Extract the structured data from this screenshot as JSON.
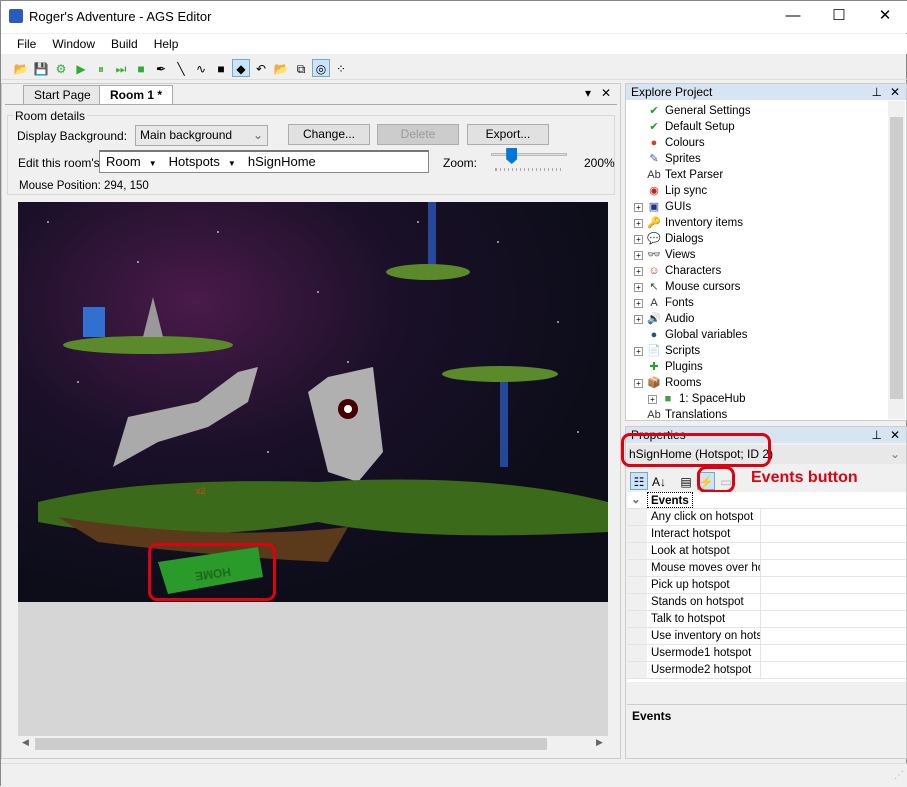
{
  "window": {
    "title": "Roger's Adventure - AGS Editor",
    "minimize": "—",
    "maximize": "☐",
    "close": "✕"
  },
  "menu": [
    "File",
    "Window",
    "Build",
    "Help"
  ],
  "toolbar_icons": [
    "open-icon",
    "save-icon",
    "build-icon",
    "run-icon",
    "pause-icon",
    "step-icon",
    "stop-icon",
    "eyedropper-icon",
    "line-icon",
    "freehand-icon",
    "rectangle-icon",
    "fill-icon",
    "undo-icon",
    "import-icon",
    "copy-walkable-icon",
    "hotspot-select-icon",
    "zoom-icon"
  ],
  "tabs": [
    {
      "label": "Start Page",
      "active": false
    },
    {
      "label": "Room 1 *",
      "active": true
    }
  ],
  "tab_controls": {
    "dropdown": "▾",
    "close": "✕"
  },
  "room": {
    "group_label": "Room details",
    "display_bg_label": "Display Background:",
    "display_bg_value": "Main background",
    "change": "Change...",
    "delete": "Delete",
    "export": "Export...",
    "edit_label": "Edit this room's:",
    "crumb1": "Room",
    "crumb2": "Hotspots",
    "crumb3": "hSignHome",
    "zoom_label": "Zoom:",
    "zoom_value": "200%",
    "zoom_level": 0.2,
    "mouse_pos": "Mouse Position: 294, 150",
    "sign_text": "HOME",
    "cursor_marker": "x2"
  },
  "explore": {
    "title": "Explore Project",
    "items": [
      {
        "label": "General Settings",
        "icon": "✔",
        "color": "#1a9a1a",
        "exp": false
      },
      {
        "label": "Default Setup",
        "icon": "✔",
        "color": "#1a9a1a",
        "exp": false
      },
      {
        "label": "Colours",
        "icon": "●",
        "color": "#d04020",
        "exp": false
      },
      {
        "label": "Sprites",
        "icon": "✎",
        "color": "#3060c0",
        "exp": false
      },
      {
        "label": "Text Parser",
        "icon": "Ab",
        "color": "#333",
        "exp": false
      },
      {
        "label": "Lip sync",
        "icon": "◉",
        "color": "#c02020",
        "exp": false
      },
      {
        "label": "GUIs",
        "icon": "▣",
        "color": "#203090",
        "exp": true
      },
      {
        "label": "Inventory items",
        "icon": "🔑",
        "color": "#c09000",
        "exp": true
      },
      {
        "label": "Dialogs",
        "icon": "💬",
        "color": "#3070c0",
        "exp": true
      },
      {
        "label": "Views",
        "icon": "👓",
        "color": "#444",
        "exp": true
      },
      {
        "label": "Characters",
        "icon": "☺",
        "color": "#c03020",
        "exp": true
      },
      {
        "label": "Mouse cursors",
        "icon": "↖",
        "color": "#444",
        "exp": true
      },
      {
        "label": "Fonts",
        "icon": "A",
        "color": "#333",
        "exp": true
      },
      {
        "label": "Audio",
        "icon": "🔊",
        "color": "#555",
        "exp": true
      },
      {
        "label": "Global variables",
        "icon": "●",
        "color": "#2050a0",
        "exp": false
      },
      {
        "label": "Scripts",
        "icon": "📄",
        "color": "#555",
        "exp": true
      },
      {
        "label": "Plugins",
        "icon": "✚",
        "color": "#3a9a30",
        "exp": false
      },
      {
        "label": "Rooms",
        "icon": "📦",
        "color": "#c08020",
        "exp": true
      },
      {
        "label": "1: SpaceHub",
        "icon": "■",
        "color": "#40a040",
        "exp": true,
        "indent": 1
      },
      {
        "label": "Translations",
        "icon": "Ab",
        "color": "#333",
        "exp": false
      }
    ]
  },
  "properties": {
    "title": "Properties",
    "object": "hSignHome (Hotspot; ID 2)",
    "annotation": "Events button",
    "category": "Events",
    "events": [
      "Any click on hotspot",
      "Interact hotspot",
      "Look at hotspot",
      "Mouse moves over hotspot",
      "Pick up hotspot",
      "Stands on hotspot",
      "Talk to hotspot",
      "Use inventory on hotspot",
      "Usermode1 hotspot",
      "Usermode2 hotspot"
    ],
    "description_title": "Events"
  },
  "colors": {
    "annotation": "#e00010",
    "accent": "#0078d7"
  }
}
